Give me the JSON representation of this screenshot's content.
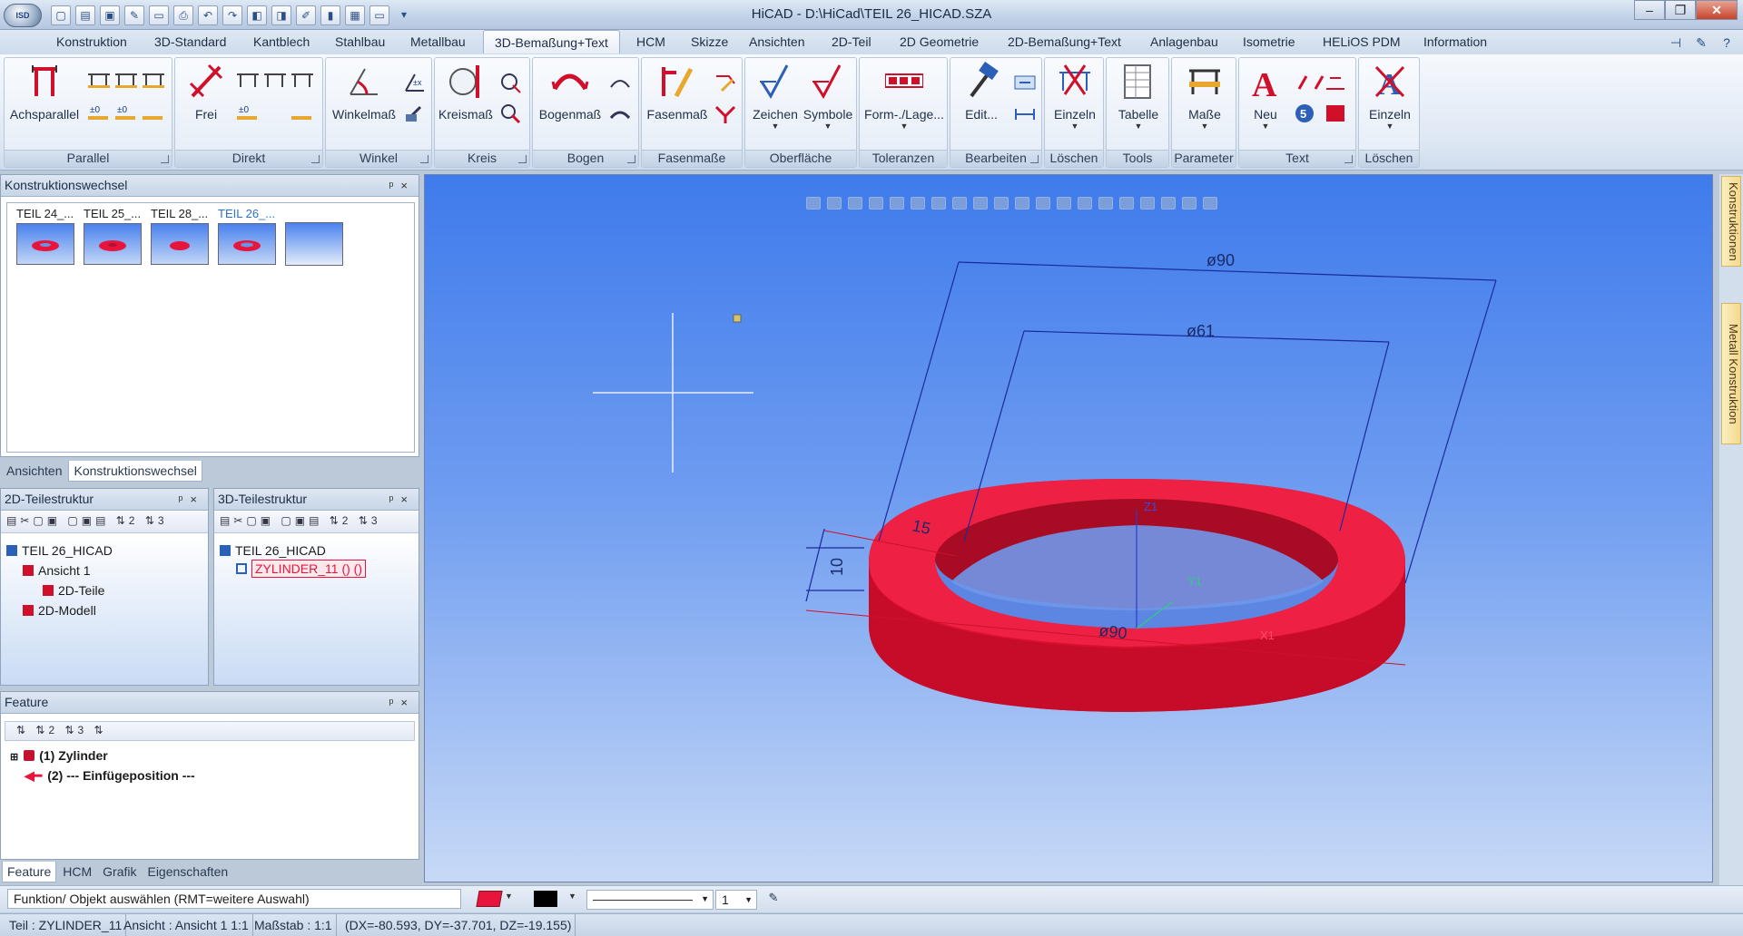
{
  "window": {
    "title": "HiCAD - D:\\HiCad\\TEIL 26_HICAD.SZA",
    "logo_text": "ISD"
  },
  "colors": {
    "accent": "#e8143c",
    "viewport_top": "#3f7bec",
    "viewport_bottom": "#c7d9f6",
    "dimension_line": "#1a2a9a"
  },
  "quick_access": [
    "new-icon",
    "open-icon",
    "save-icon",
    "tools-icon",
    "folder-icon",
    "print-icon",
    "undo-icon",
    "redo-icon",
    "view-icon",
    "view2-icon",
    "edit-icon",
    "bar-icon",
    "image-icon",
    "screen-icon"
  ],
  "ribbon_tabs": [
    "Konstruktion",
    "3D-Standard",
    "Kantblech",
    "Stahlbau",
    "Metallbau",
    "3D-Bemaßung+Text",
    "HCM",
    "Skizze",
    "Ansichten",
    "2D-Teil",
    "2D Geometrie",
    "2D-Bemaßung+Text",
    "Anlagenbau",
    "Isometrie",
    "HELiOS PDM",
    "Information"
  ],
  "active_tab": "3D-Bemaßung+Text",
  "ribbon": {
    "groups": {
      "parallel": "Parallel",
      "direkt": "Direkt",
      "winkel": "Winkel",
      "kreis": "Kreis",
      "bogen": "Bogen",
      "fasenmasse": "Fasenmaße",
      "oberflaeche": "Oberfläche",
      "toleranzen": "Toleranzen",
      "bearbeiten": "Bearbeiten",
      "loeschen": "Löschen",
      "tools": "Tools",
      "parameter": "Parameter",
      "text": "Text",
      "loeschen2": "Löschen"
    },
    "buttons": {
      "achsparallel": "Achsparallel",
      "frei": "Frei",
      "winkelmass": "Winkelmaß",
      "kreismass": "Kreismaß",
      "bogenmass": "Bogenmaß",
      "fasenmass": "Fasenmaß",
      "zeichen": "Zeichen",
      "symbole": "Symbole",
      "formlage": "Form-./Lage...",
      "edit": "Edit...",
      "einzeln": "Einzeln",
      "tabelle": "Tabelle",
      "masse": "Maße",
      "neu": "Neu",
      "einzeln2": "Einzeln"
    }
  },
  "konstruktionswechsel": {
    "title": "Konstruktionswechsel",
    "items": [
      {
        "label": "TEIL 24_..."
      },
      {
        "label": "TEIL 25_..."
      },
      {
        "label": "TEIL 28_..."
      },
      {
        "label": "TEIL 26_..."
      }
    ],
    "tabs": [
      "Ansichten",
      "Konstruktionswechsel"
    ]
  },
  "teilestruktur_2d": {
    "title": "2D-Teilestruktur",
    "items": [
      "TEIL 26_HICAD",
      "Ansicht 1",
      "2D-Teile",
      "2D-Modell"
    ]
  },
  "teilestruktur_3d": {
    "title": "3D-Teilestruktur",
    "items": [
      "TEIL 26_HICAD",
      "ZYLINDER_11 () ()"
    ]
  },
  "feature": {
    "title": "Feature",
    "items": [
      "(1) Zylinder",
      "(2) --- Einfügeposition ---"
    ],
    "tabs": [
      "Feature",
      "HCM",
      "Grafik",
      "Eigenschaften"
    ]
  },
  "viewport": {
    "dimensions": {
      "outer_top": "ø90",
      "inner_top": "ø61",
      "thickness": "10",
      "wall": "15",
      "bottom": "ø90"
    },
    "axes": {
      "z": "Z1",
      "y": "Y1",
      "x": "X1"
    }
  },
  "side_tabs": [
    "Konstruktionen",
    "Metall Konstruktion"
  ],
  "command_line": {
    "prompt": "Funktion/ Objekt auswählen (RMT=weitere Auswahl)",
    "line_width": "1"
  },
  "status": {
    "teil": "Teil : ZYLINDER_11",
    "ansicht": "Ansicht : Ansicht 1 1:1",
    "massstab": "Maßstab : 1:1",
    "coords": "(DX=-80.593, DY=-37.701, DZ=-19.155)"
  }
}
